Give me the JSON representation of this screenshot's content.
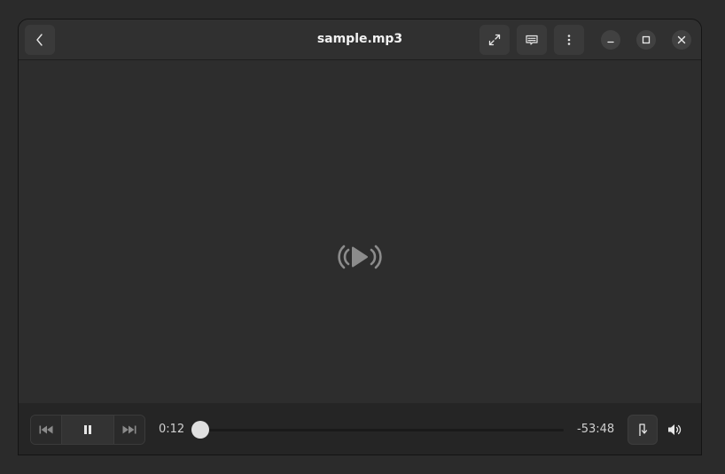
{
  "window": {
    "title": "sample.mp3"
  },
  "headerbar": {
    "back_icon": "go-previous-icon",
    "fullscreen_icon": "view-fullscreen-icon",
    "subtitles_icon": "subtitles-icon",
    "menu_icon": "view-more-icon",
    "minimize_icon": "window-minimize-icon",
    "maximize_icon": "window-maximize-icon",
    "close_icon": "window-close-icon"
  },
  "content": {
    "center_icon": "audio-playing-icon"
  },
  "controls": {
    "previous_icon": "media-skip-backward-icon",
    "play_pause_icon": "media-playback-pause-icon",
    "next_icon": "media-skip-forward-icon",
    "elapsed": "0:12",
    "remaining": "-53:48",
    "progress_fraction": 0.004,
    "repeat_icon": "media-playlist-consecutive-icon",
    "volume_icon": "audio-volume-high-icon"
  },
  "colors": {
    "background": "#2d2d2d",
    "headerbar": "#303030",
    "controls_bar": "#252525",
    "text": "#f2f2f2"
  }
}
